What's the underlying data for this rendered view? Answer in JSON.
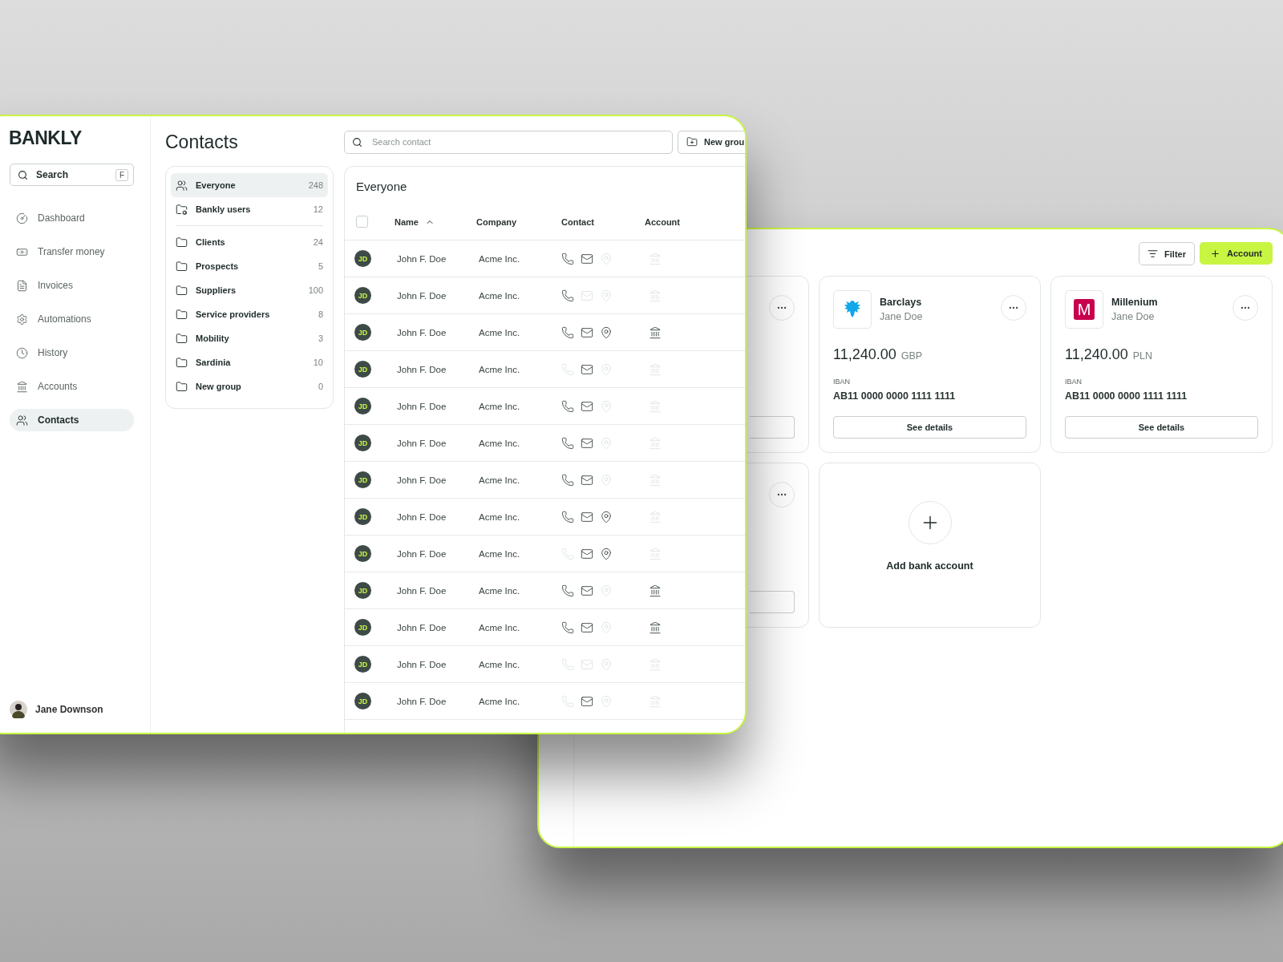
{
  "contacts_window": {
    "sidebar": {
      "logo": "BANKLY",
      "search": {
        "placeholder": "Search",
        "shortcut": "F"
      },
      "items": [
        {
          "label": "Dashboard",
          "selected": false
        },
        {
          "label": "Transfer money",
          "selected": false
        },
        {
          "label": "Invoices",
          "selected": false
        },
        {
          "label": "Automations",
          "selected": false
        },
        {
          "label": "History",
          "selected": false
        },
        {
          "label": "Accounts",
          "selected": false
        },
        {
          "label": "Contacts",
          "selected": true
        }
      ],
      "user": {
        "name": "Jane Downson"
      }
    },
    "title": "Contacts",
    "search": {
      "placeholder": "Search contact"
    },
    "new_group_button": "New grou",
    "groups": [
      {
        "kind": "all",
        "label": "Everyone",
        "count": "248",
        "selected": true
      },
      {
        "kind": "system",
        "label": "Bankly users",
        "count": "12",
        "selected": false
      },
      {
        "kind": "folder",
        "label": "Clients",
        "count": "24",
        "selected": false
      },
      {
        "kind": "folder",
        "label": "Prospects",
        "count": "5",
        "selected": false
      },
      {
        "kind": "folder",
        "label": "Suppliers",
        "count": "100",
        "selected": false
      },
      {
        "kind": "folder",
        "label": "Service providers",
        "count": "8",
        "selected": false
      },
      {
        "kind": "folder",
        "label": "Mobility",
        "count": "3",
        "selected": false
      },
      {
        "kind": "folder",
        "label": "Sardinia",
        "count": "10",
        "selected": false
      },
      {
        "kind": "folder",
        "label": "New group",
        "count": "0",
        "selected": false
      }
    ],
    "table": {
      "title": "Everyone",
      "select_all": {
        "checked": false
      },
      "columns": [
        "Name",
        "Company",
        "Contact",
        "Account"
      ],
      "rows": [
        {
          "initials": "JD",
          "name": "John F. Doe",
          "company": "Acme Inc.",
          "phone": true,
          "email": true,
          "location": false,
          "bank": false
        },
        {
          "initials": "JD",
          "name": "John F. Doe",
          "company": "Acme Inc.",
          "phone": true,
          "email": false,
          "location": false,
          "bank": false
        },
        {
          "initials": "JD",
          "name": "John F. Doe",
          "company": "Acme Inc.",
          "phone": true,
          "email": true,
          "location": true,
          "bank": true
        },
        {
          "initials": "JD",
          "name": "John F. Doe",
          "company": "Acme Inc.",
          "phone": false,
          "email": true,
          "location": false,
          "bank": false
        },
        {
          "initials": "JD",
          "name": "John F. Doe",
          "company": "Acme Inc.",
          "phone": true,
          "email": true,
          "location": false,
          "bank": false
        },
        {
          "initials": "JD",
          "name": "John F. Doe",
          "company": "Acme Inc.",
          "phone": true,
          "email": true,
          "location": false,
          "bank": false
        },
        {
          "initials": "JD",
          "name": "John F. Doe",
          "company": "Acme Inc.",
          "phone": true,
          "email": true,
          "location": false,
          "bank": false
        },
        {
          "initials": "JD",
          "name": "John F. Doe",
          "company": "Acme Inc.",
          "phone": true,
          "email": true,
          "location": true,
          "bank": false
        },
        {
          "initials": "JD",
          "name": "John F. Doe",
          "company": "Acme Inc.",
          "phone": false,
          "email": true,
          "location": true,
          "bank": false
        },
        {
          "initials": "JD",
          "name": "John F. Doe",
          "company": "Acme Inc.",
          "phone": true,
          "email": true,
          "location": false,
          "bank": true
        },
        {
          "initials": "JD",
          "name": "John F. Doe",
          "company": "Acme Inc.",
          "phone": true,
          "email": true,
          "location": false,
          "bank": true
        },
        {
          "initials": "JD",
          "name": "John F. Doe",
          "company": "Acme Inc.",
          "phone": false,
          "email": false,
          "location": false,
          "bank": false
        },
        {
          "initials": "JD",
          "name": "John F. Doe",
          "company": "Acme Inc.",
          "phone": false,
          "email": true,
          "location": false,
          "bank": false
        }
      ]
    }
  },
  "accounts_window": {
    "filter_button": "Filter",
    "add_account_button": "Account",
    "cards": [
      {
        "kind": "partial"
      },
      {
        "kind": "account",
        "bank": "Barclays",
        "holder": "Jane Doe",
        "amount": "11,240.00",
        "currency": "GBP",
        "iban_label": "IBAN",
        "iban": "AB11 0000 0000 1111 1111",
        "button": "See details"
      },
      {
        "kind": "account",
        "bank": "Millenium",
        "holder": "Jane Doe",
        "logo_text": "M",
        "amount": "11,240.00",
        "currency": "PLN",
        "iban_label": "IBAN",
        "iban": "AB11 0000 0000 1111 1111",
        "button": "See details"
      },
      {
        "kind": "partial"
      },
      {
        "kind": "add",
        "label": "Add bank account"
      }
    ]
  }
}
